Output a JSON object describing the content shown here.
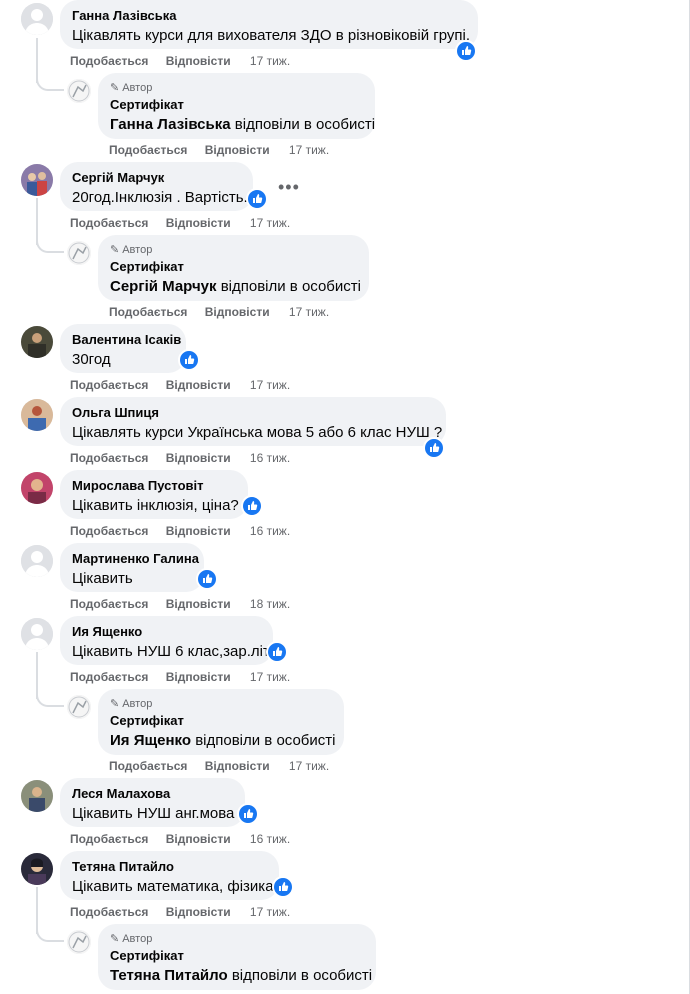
{
  "labels": {
    "like": "Подобається",
    "reply": "Відповісти",
    "author_badge": "Автор",
    "replied_suffix": "відповіли в особисті"
  },
  "comments": [
    {
      "author": "Ганна Лазівська",
      "text": "Цікавлять курси для вихователя ЗДО в різновіковій групі.",
      "time": "17 тиж.",
      "reply": {
        "author": "Сертифікат",
        "mention": "Ганна Лазівська",
        "time": "17 тиж."
      }
    },
    {
      "author": "Сергій Марчук",
      "text": "20год.Інклюзія . Вартість.",
      "time": "17 тиж.",
      "more": "•••",
      "reply": {
        "author": "Сертифікат",
        "mention": "Сергій Марчук",
        "time": "17 тиж."
      }
    },
    {
      "author": "Валентина Ісаків",
      "text": "30год",
      "time": "17 тиж."
    },
    {
      "author": "Ольга Шпиця",
      "text": "Цікавлять курси Українська мова 5 або 6 клас НУШ ?",
      "time": "16 тиж."
    },
    {
      "author": "Мирослава Пустовіт",
      "text": "Цікавить інклюзія, ціна?",
      "time": "16 тиж."
    },
    {
      "author": "Мартиненко Галина",
      "text": "Цікавить",
      "time": "18 тиж."
    },
    {
      "author": "Ия Ященко",
      "text": "Цікавить НУШ 6 клас,зар.літ",
      "time": "17 тиж.",
      "reply": {
        "author": "Сертифікат",
        "mention": "Ия Ященко",
        "time": "17 тиж."
      }
    },
    {
      "author": "Леся Малахова",
      "text": "Цікавить НУШ анг.мова",
      "time": "16 тиж."
    },
    {
      "author": "Тетяна Питайло",
      "text": "Цікавить математика, фізика",
      "time": "17 тиж.",
      "reply": {
        "author": "Сертифікат",
        "mention": "Тетяна Питайло",
        "time": null
      }
    }
  ],
  "colors": {
    "accent": "#1877f2",
    "bubble": "#f0f2f5",
    "muted": "#65676b"
  }
}
